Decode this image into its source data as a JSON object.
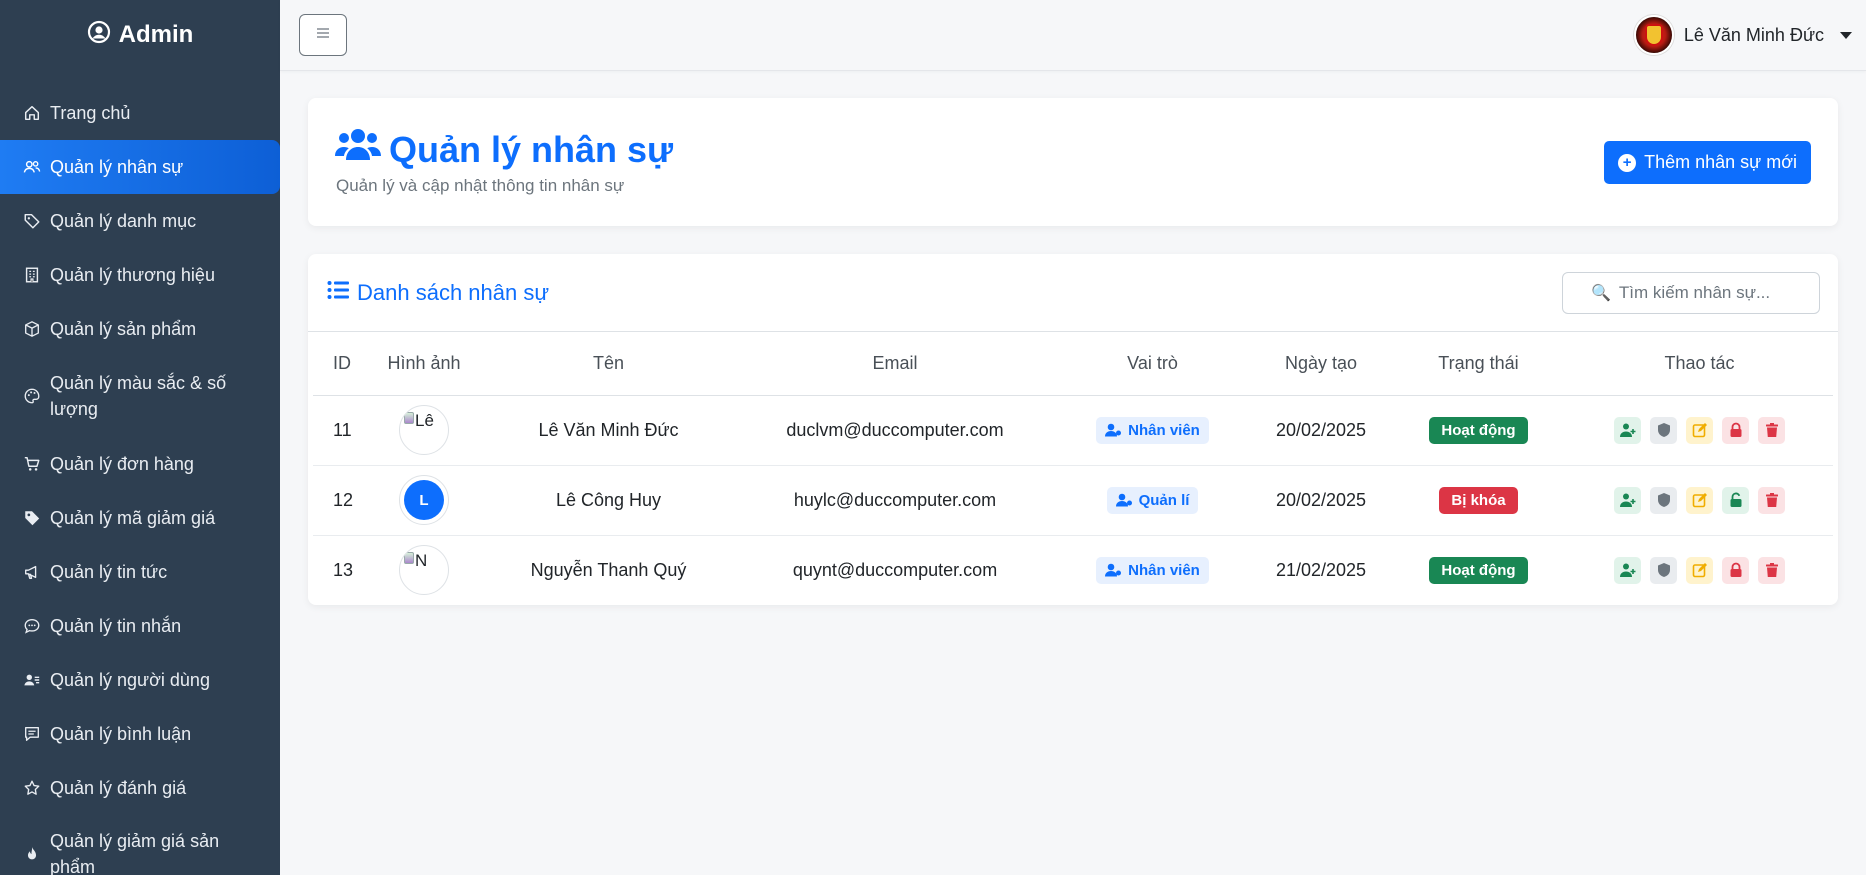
{
  "sidebar": {
    "brand": "Admin",
    "items": [
      {
        "label": "Trang chủ",
        "icon": "home-icon"
      },
      {
        "label": "Quản lý nhân sự",
        "icon": "users-icon",
        "active": true
      },
      {
        "label": "Quản lý danh mục",
        "icon": "tags-icon"
      },
      {
        "label": "Quản lý thương hiệu",
        "icon": "building-icon"
      },
      {
        "label": "Quản lý sản phẩm",
        "icon": "box-icon"
      },
      {
        "label": "Quản lý màu sắc & số lượng",
        "icon": "palette-icon"
      },
      {
        "label": "Quản lý đơn hàng",
        "icon": "cart-icon"
      },
      {
        "label": "Quản lý mã giảm giá",
        "icon": "tag-icon"
      },
      {
        "label": "Quản lý tin tức",
        "icon": "megaphone-icon"
      },
      {
        "label": "Quản lý tin nhắn",
        "icon": "chat-icon"
      },
      {
        "label": "Quản lý người dùng",
        "icon": "user-id-icon"
      },
      {
        "label": "Quản lý bình luận",
        "icon": "comment-icon"
      },
      {
        "label": "Quản lý đánh giá",
        "icon": "star-icon"
      },
      {
        "label": "Quản lý giảm giá sản phẩm",
        "icon": "fire-icon"
      }
    ]
  },
  "topbar": {
    "user_name": "Lê Văn Minh Đức"
  },
  "header": {
    "title": "Quản lý nhân sự",
    "subtitle": "Quản lý và cập nhật thông tin nhân sự",
    "add_button": "Thêm nhân sự mới"
  },
  "list": {
    "title": "Danh sách nhân sự",
    "search_placeholder": "Tìm kiếm nhân sự...",
    "columns": [
      "ID",
      "Hình ảnh",
      "Tên",
      "Email",
      "Vai trò",
      "Ngày tạo",
      "Trạng thái",
      "Thao tác"
    ],
    "rows": [
      {
        "id": "11",
        "image_alt": "Lê",
        "avatar_letter": "",
        "name": "Lê Văn Minh Đức",
        "email": "duclvm@duccomputer.com",
        "role": "Nhân viên",
        "created": "20/02/2025",
        "status": "Hoạt động",
        "status_color": "#198754",
        "locked": false
      },
      {
        "id": "12",
        "image_alt": "",
        "avatar_letter": "L",
        "name": "Lê Công Huy",
        "email": "huylc@duccomputer.com",
        "role": "Quản lí",
        "created": "20/02/2025",
        "status": "Bị khóa",
        "status_color": "#dc3545",
        "locked": true
      },
      {
        "id": "13",
        "image_alt": "N",
        "avatar_letter": "",
        "name": "Nguyễn Thanh Quý",
        "email": "quynt@duccomputer.com",
        "role": "Nhân viên",
        "created": "21/02/2025",
        "status": "Hoạt động",
        "status_color": "#198754",
        "locked": false
      }
    ]
  },
  "colors": {
    "primary": "#0d6efd",
    "sidebar_bg": "#2e3f51",
    "success": "#198754",
    "danger": "#dc3545",
    "warning": "#ffc107"
  }
}
